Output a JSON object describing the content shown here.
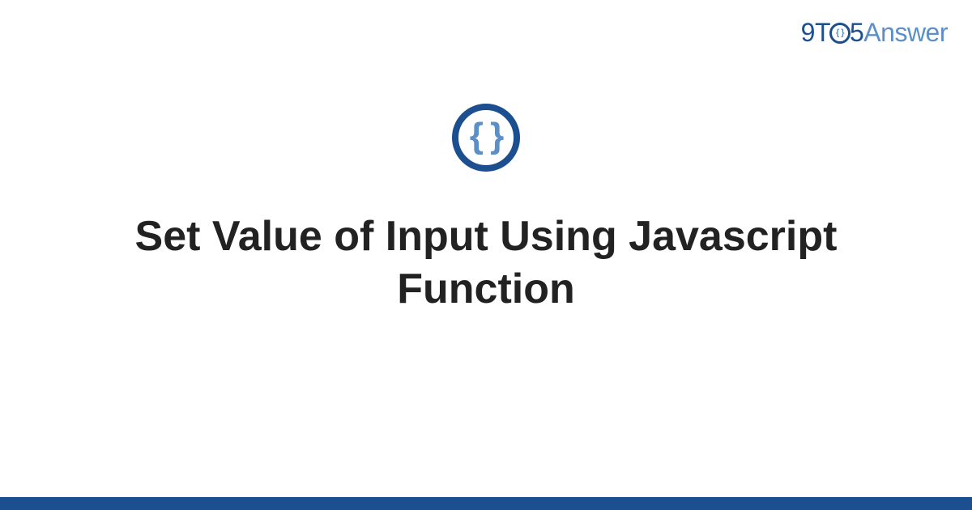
{
  "brand": {
    "part_9": "9",
    "part_T": "T",
    "part_O_inner": "{ }",
    "part_5": "5",
    "part_answer": "Answer"
  },
  "badge": {
    "glyph": "{ }"
  },
  "page": {
    "title": "Set Value of Input Using Javascript Function"
  },
  "colors": {
    "brand_dark": "#1b4f8f",
    "brand_light": "#5b8fc7",
    "text": "#222222"
  }
}
